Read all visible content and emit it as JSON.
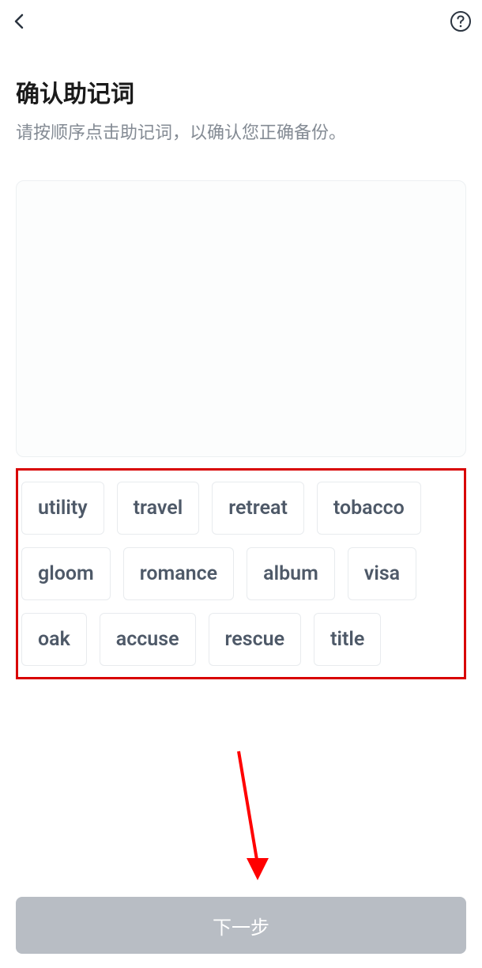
{
  "header": {
    "title": "确认助记词",
    "subtitle": "请按顺序点击助记词，以确认您正确备份。"
  },
  "words": [
    "utility",
    "travel",
    "retreat",
    "tobacco",
    "gloom",
    "romance",
    "album",
    "visa",
    "oak",
    "accuse",
    "rescue",
    "title"
  ],
  "footer": {
    "next_label": "下一步"
  },
  "annotations": {
    "highlight_color": "#d80000",
    "arrow_color": "#ff0000"
  }
}
